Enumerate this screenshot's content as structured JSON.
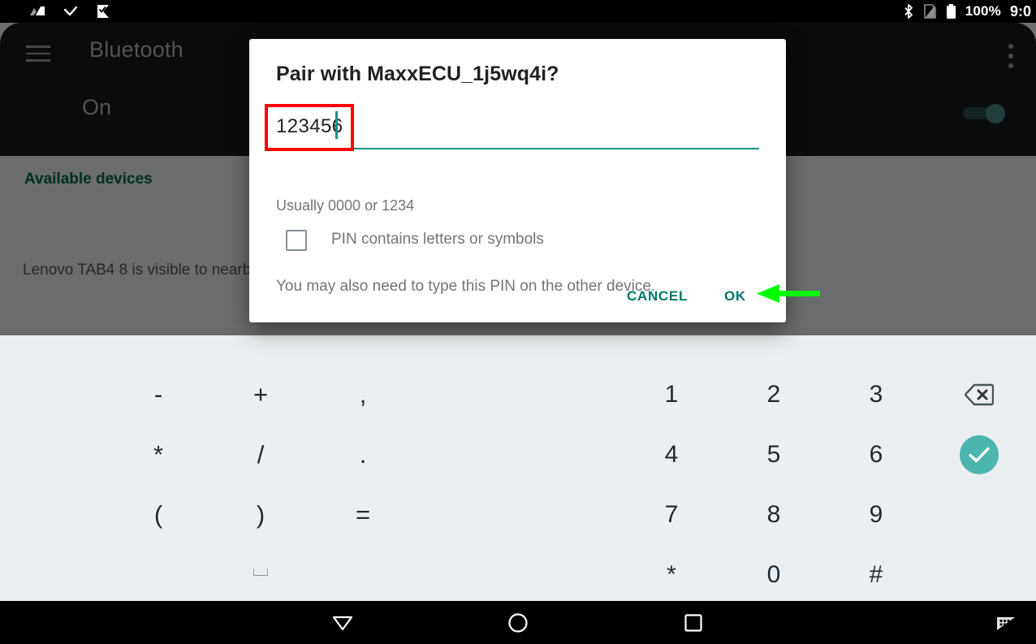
{
  "status_bar": {
    "left_icons": [
      "signal-activity-icon",
      "checkmark-icon",
      "flag-check-icon"
    ],
    "bluetooth_icon": "bluetooth-icon",
    "sim_icon": "no-sim-icon",
    "battery_icon": "battery-full-icon",
    "battery_label": "100%",
    "time": "9:0"
  },
  "settings": {
    "menu_icon": "hamburger-menu-icon",
    "title": "Bluetooth",
    "overflow_icon": "overflow-menu-icon",
    "state_label": "On",
    "toggle_on": true,
    "section_header": "Available devices",
    "visible_note": "Lenovo TAB4 8 is visible to nearb",
    "accent_color": "#00694d"
  },
  "dialog": {
    "title": "Pair with MaxxECU_1j5wq4i?",
    "pin_value": "123456",
    "pin_placeholder": "",
    "pin_hint": "Usually 0000 or 1234",
    "checkbox_label": "PIN contains letters or symbols",
    "checkbox_checked": false,
    "note": "You may also need to type this PIN on the other device.",
    "cancel_label": "CANCEL",
    "ok_label": "OK",
    "accent_color": "#00786a"
  },
  "annotations": {
    "highlight_box_color": "#ff0000",
    "arrow_color": "#00ff00",
    "highlight_target": "pin-input-field",
    "arrow_target": "ok-button"
  },
  "keyboard": {
    "symbol_rows": [
      [
        "-",
        "+",
        ","
      ],
      [
        "*",
        "/",
        "."
      ],
      [
        "(",
        ")",
        "="
      ]
    ],
    "space_label": "⌴",
    "number_rows": [
      [
        "1",
        "2",
        "3"
      ],
      [
        "4",
        "5",
        "6"
      ],
      [
        "7",
        "8",
        "9"
      ],
      [
        "*",
        "0",
        "#"
      ]
    ],
    "backspace_icon": "backspace-icon",
    "enter_icon": "checkmark-icon"
  },
  "navbar": {
    "back_icon": "back-triangle-icon",
    "home_icon": "home-circle-icon",
    "recents_icon": "recents-square-icon",
    "ime_icon": "keyboard-switcher-icon"
  }
}
